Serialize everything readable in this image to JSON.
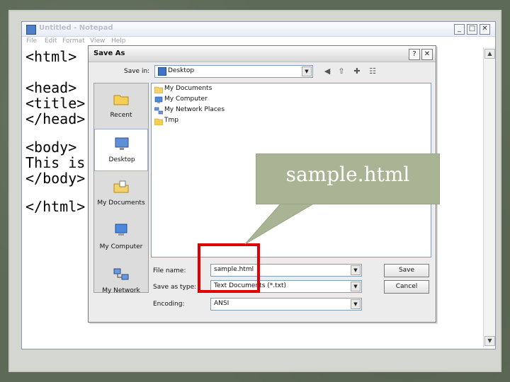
{
  "notepad": {
    "title": "Untitled - Notepad",
    "menu": [
      "File",
      "Edit",
      "Format",
      "View",
      "Help"
    ],
    "lines": [
      "<html>",
      "<head>",
      "<title>",
      "</head>",
      "<body>",
      "This is",
      "</body>",
      "</html>"
    ],
    "window_buttons": [
      "_",
      "□",
      "✕"
    ],
    "scroll_up": "▲",
    "scroll_down": "▼"
  },
  "dialog": {
    "title": "Save As",
    "window_buttons": [
      "?",
      "✕"
    ],
    "save_in_label": "Save in:",
    "save_in_value": "Desktop",
    "toolbar_icons": [
      "back-icon",
      "up-folder-icon",
      "new-folder-icon",
      "views-menu-icon"
    ],
    "places": [
      {
        "label": "Recent",
        "icon": "recent-folder-icon"
      },
      {
        "label": "Desktop",
        "icon": "desktop-icon"
      },
      {
        "label": "My Documents",
        "icon": "my-documents-icon"
      },
      {
        "label": "My Computer",
        "icon": "my-computer-icon"
      },
      {
        "label": "My Network",
        "icon": "my-network-icon"
      }
    ],
    "files": [
      {
        "name": "My Documents",
        "icon": "documents-folder-icon"
      },
      {
        "name": "My Computer",
        "icon": "computer-icon"
      },
      {
        "name": "My Network Places",
        "icon": "network-places-icon"
      },
      {
        "name": "Tmp",
        "icon": "folder-icon"
      }
    ],
    "file_name_label": "File name:",
    "file_name_value": "sample.html",
    "save_as_type_label": "Save as type:",
    "save_as_type_value": "Text Documents (*.txt)",
    "encoding_label": "Encoding:",
    "encoding_value": "ANSI",
    "save_button": "Save",
    "cancel_button": "Cancel"
  },
  "callout": {
    "text": "sample.html"
  },
  "colors": {
    "highlight": "#e00000",
    "callout_bg": "#a9b494"
  }
}
